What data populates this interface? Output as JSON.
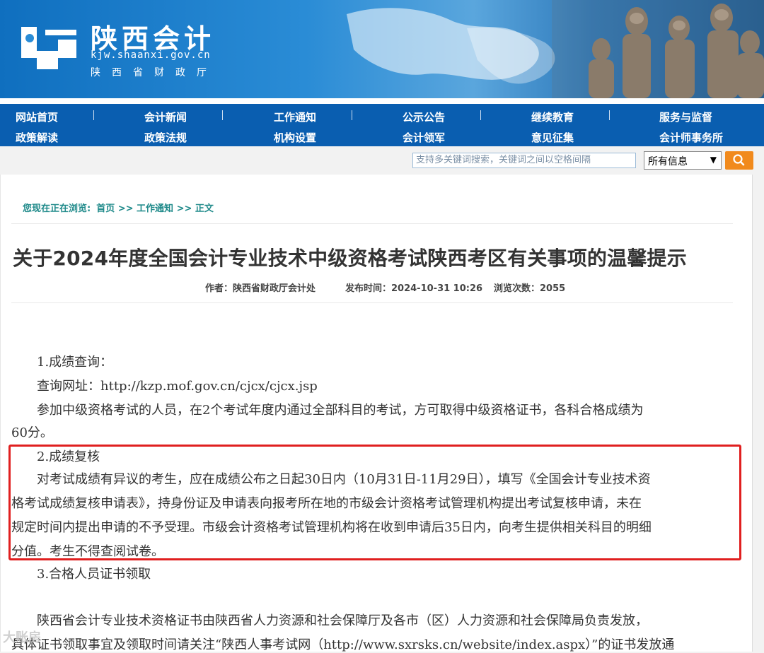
{
  "header": {
    "site_title": "陕西会计",
    "domain": "kjw.shaanxi.gov.cn",
    "org": "陕西省财政厅"
  },
  "nav": {
    "row1": [
      "网站首页",
      "会计新闻",
      "工作通知",
      "公示公告",
      "继续教育",
      "服务与监督"
    ],
    "row2": [
      "政策解读",
      "政策法规",
      "机构设置",
      "会计领军",
      "意见征集",
      "会计师事务所"
    ]
  },
  "search": {
    "placeholder": "支持多关键词搜索，关键词之间以空格间隔",
    "scope": "所有信息"
  },
  "breadcrumb": {
    "label": "您现在正在浏览:",
    "path": "首页 >> 工作通知 >> 正文"
  },
  "article": {
    "title": "关于2024年度全国会计专业技术中级资格考试陕西考区有关事项的温馨提示",
    "author": "作者：陕西省财政厅会计处",
    "published": "发布时间：2024-10-31 10:26",
    "views": "浏览次数：2055",
    "lines": [
      "　　1.成绩查询：",
      "　　查询网址：http://kzp.mof.gov.cn/cjcx/cjcx.jsp",
      "　　参加中级资格考试的人员，在2个考试年度内通过全部科目的考试，方可取得中级资格证书，各科合格成绩为",
      "60分。",
      "　　2.成绩复核",
      "　　对考试成绩有异议的考生，应在成绩公布之日起30日内（10月31日-11月29日），填写《全国会计专业技术资",
      "格考试成绩复核申请表》，持身份证及申请表向报考所在地的市级会计资格考试管理机构提出考试复核申请，未在",
      "规定时间内提出申请的不予受理。市级会计资格考试管理机构将在收到申请后35日内，向考生提供相关科目的明细",
      "分值。考生不得查阅试卷。",
      "　　3.合格人员证书领取",
      "",
      "　　陕西省会计专业技术资格证书由陕西省人力资源和社会保障厅及各市（区）人力资源和社会保障局负责发放，",
      "具体证书领取事宜及领取时间请关注“陕西人事考试网（http://www.sxrsks.cn/website/index.aspx）”的证书发放通"
    ]
  },
  "watermark": "大账房"
}
